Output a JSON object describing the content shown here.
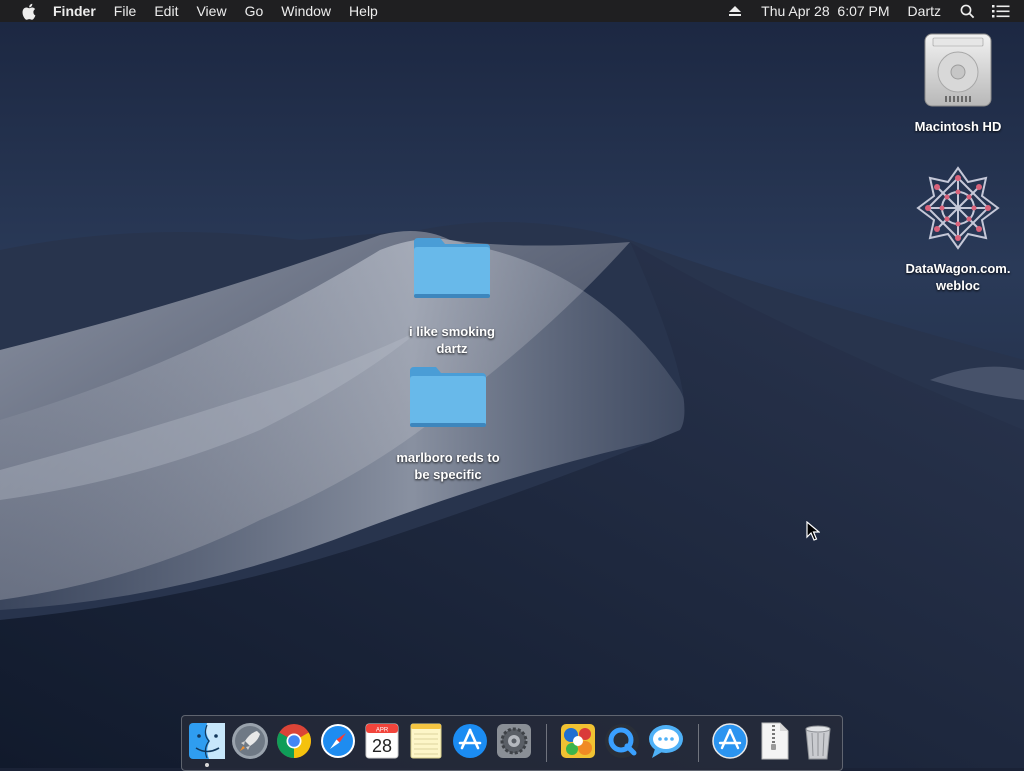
{
  "menubar": {
    "app_name": "Finder",
    "menus": [
      "File",
      "Edit",
      "View",
      "Go",
      "Window",
      "Help"
    ],
    "clock": "Thu Apr 28  6:07 PM",
    "user": "Dartz",
    "icons": [
      "apple-icon",
      "eject-icon",
      "spotlight-icon",
      "notification-center-icon"
    ]
  },
  "desktop": {
    "icons": [
      {
        "label": "Macintosh HD",
        "icon": "hard-drive-icon"
      },
      {
        "label": "DataWagon.com.\nwebloc",
        "icon": "webloc-icon"
      },
      {
        "label": "i like smoking\ndartz",
        "icon": "folder-icon"
      },
      {
        "label": "marlboro reds to\nbe specific",
        "icon": "folder-icon"
      }
    ]
  },
  "dock": {
    "calendar": {
      "month": "APR",
      "day": "28"
    },
    "items": [
      "Finder",
      "Launchpad",
      "Google Chrome",
      "Safari",
      "Calendar",
      "Notes",
      "App Store",
      "System Preferences",
      "Sonic Game",
      "QuickTime Player",
      "Messages",
      "Downloads",
      "Documents",
      "Trash"
    ]
  },
  "colors": {
    "menubar_bg": "#1f1f21",
    "folder_blue": "#5fb3e6",
    "wallpaper_sky": "#233453"
  }
}
